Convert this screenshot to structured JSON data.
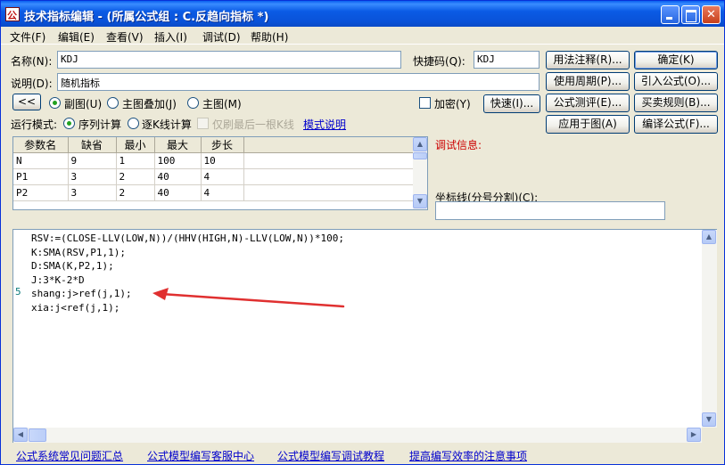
{
  "window": {
    "title": "技术指标编辑 - (所属公式组 : C.反趋向指标 *)"
  },
  "menu": [
    "文件(F)",
    "编辑(E)",
    "查看(V)",
    "插入(I)",
    "调试(D)",
    "帮助(H)"
  ],
  "form": {
    "name_label": "名称(N):",
    "name_value": "KDJ",
    "shortcut_label": "快捷码(Q):",
    "shortcut_value": "KDJ",
    "desc_label": "说明(D):",
    "desc_value": "随机指标",
    "collapse_btn": "<<",
    "radio_sub": "副图(U)",
    "radio_overlay": "主图叠加(J)",
    "radio_main": "主图(M)",
    "encrypt_label": "加密(Y)",
    "quick_btn": "快速(I)...",
    "run_mode_label": "运行模式:",
    "mode_seq": "序列计算",
    "mode_kline": "逐K线计算",
    "mode_lastonly": "仅刷最后一根K线",
    "mode_help_link": "模式说明"
  },
  "right_buttons": {
    "usage": "用法注释(R)...",
    "confirm": "确定(K)",
    "period": "使用周期(P)...",
    "import": "引入公式(O)...",
    "test": "公式测评(E)...",
    "rules": "买卖规则(B)...",
    "apply": "应用于图(A)",
    "compile": "编译公式(F)..."
  },
  "params": {
    "headers": [
      "参数名",
      "缺省",
      "最小",
      "最大",
      "步长"
    ],
    "rows": [
      [
        "N",
        "9",
        "1",
        "100",
        "10"
      ],
      [
        "P1",
        "3",
        "2",
        "40",
        "4"
      ],
      [
        "P2",
        "3",
        "2",
        "40",
        "4"
      ]
    ]
  },
  "debug": {
    "label": "调试信息:",
    "coord_label": "坐标线(分号分割)(C):",
    "coord_value": ""
  },
  "code_lines": [
    "RSV:=(CLOSE-LLV(LOW,N))/(HHV(HIGH,N)-LLV(LOW,N))*100;",
    "K:SMA(RSV,P1,1);",
    "D:SMA(K,P2,1);",
    "J:3*K-2*D",
    "shang:j>ref(j,1);",
    "xia:j<ref(j,1);"
  ],
  "gutter_marker": "5",
  "footer": {
    "links": [
      "公式系统常见问题汇总",
      "公式模型编写客服中心",
      "公式模型编写调试教程",
      "提高编写效率的注意事项"
    ]
  },
  "colors": {
    "title_bar": "#0A5FEF",
    "debug_label": "#CC0000",
    "link": "#0000CC",
    "annotation_arrow": "#E03030"
  }
}
